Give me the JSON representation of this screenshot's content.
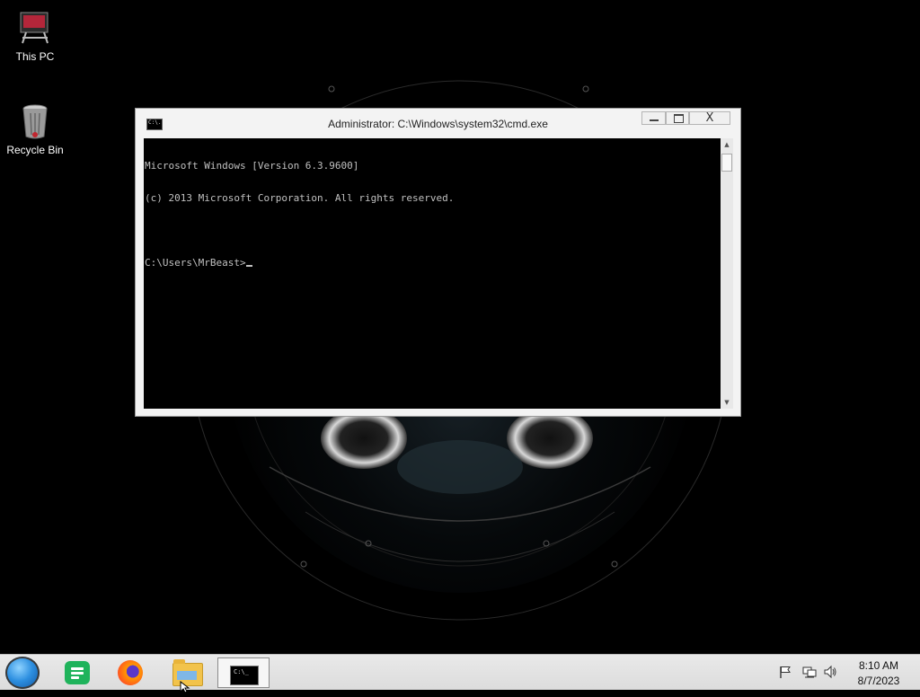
{
  "desktop": {
    "icons": [
      {
        "label": "This PC",
        "icon": "this-pc-icon"
      },
      {
        "label": "Recycle Bin",
        "icon": "recycle-bin-icon"
      }
    ]
  },
  "window": {
    "title": "Administrator: C:\\Windows\\system32\\cmd.exe",
    "minimize_label": "",
    "maximize_label": "",
    "close_label": "X",
    "console": {
      "lines": [
        "Microsoft Windows [Version 6.3.9600]",
        "(c) 2013 Microsoft Corporation. All rights reserved.",
        "",
        "C:\\Users\\MrBeast>"
      ]
    }
  },
  "taskbar": {
    "items": [
      {
        "name": "start",
        "icon": "start-orb-icon"
      },
      {
        "name": "notes",
        "icon": "notes-app-icon"
      },
      {
        "name": "firefox",
        "icon": "firefox-icon"
      },
      {
        "name": "file-explorer",
        "icon": "folder-icon"
      },
      {
        "name": "command-prompt",
        "icon": "cmd-icon",
        "glyph_text": "C:\\_"
      }
    ],
    "tray": {
      "icons": [
        "action-center-flag-icon",
        "network-icon",
        "volume-icon"
      ],
      "time": "8:10 AM",
      "date": "8/7/2023"
    }
  },
  "colors": {
    "desktop_bg": "#000000",
    "console_bg": "#000000",
    "console_text": "#c0c0c0",
    "taskbar_bg": "#e2e2e2"
  }
}
